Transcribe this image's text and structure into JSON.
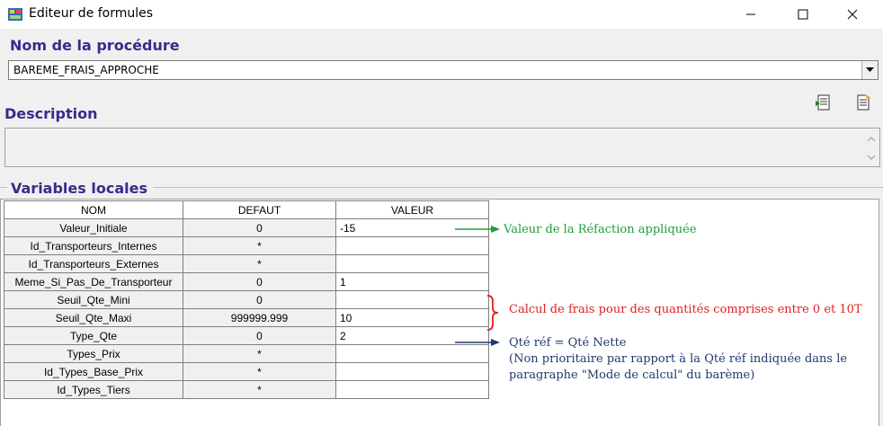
{
  "window": {
    "title": "Editeur de formules"
  },
  "procedure": {
    "heading": "Nom de la procédure",
    "value": "BAREME_FRAIS_APPROCHE"
  },
  "description": {
    "heading": "Description",
    "value": ""
  },
  "variables": {
    "heading": "Variables locales",
    "columns": [
      "NOM",
      "DEFAUT",
      "VALEUR"
    ],
    "rows": [
      {
        "nom": "Valeur_Initiale",
        "defaut": "0",
        "valeur": "-15"
      },
      {
        "nom": "Id_Transporteurs_Internes",
        "defaut": "*",
        "valeur": ""
      },
      {
        "nom": "Id_Transporteurs_Externes",
        "defaut": "*",
        "valeur": ""
      },
      {
        "nom": "Meme_Si_Pas_De_Transporteur",
        "defaut": "0",
        "valeur": "1"
      },
      {
        "nom": "Seuil_Qte_Mini",
        "defaut": "0",
        "valeur": ""
      },
      {
        "nom": "Seuil_Qte_Maxi",
        "defaut": "999999.999",
        "valeur": "10"
      },
      {
        "nom": "Type_Qte",
        "defaut": "0",
        "valeur": "2"
      },
      {
        "nom": "Types_Prix",
        "defaut": "*",
        "valeur": ""
      },
      {
        "nom": "Id_Types_Base_Prix",
        "defaut": "*",
        "valeur": ""
      },
      {
        "nom": "Id_Types_Tiers",
        "defaut": "*",
        "valeur": ""
      }
    ]
  },
  "annotations": {
    "refaction": "Valeur de la Réfaction appliquée",
    "calcul": "Calcul de frais pour des quantités comprises entre 0 et 10T",
    "qte_line1": "Qté réf = Qté Nette",
    "qte_line2": "(Non prioritaire par rapport à la Qté réf indiquée dans le",
    "qte_line3": "paragraphe \"Mode de calcul\" du barème)"
  },
  "colors": {
    "heading": "#3a2a8c",
    "annot_green": "#1f9e3a",
    "annot_red": "#e02020",
    "annot_blue": "#1f3a6e"
  }
}
